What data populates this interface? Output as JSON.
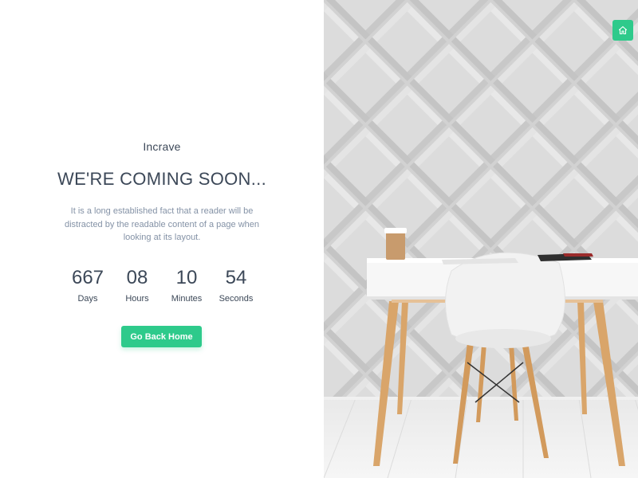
{
  "brand": "Incrave",
  "heading": "WE'RE COMING SOON...",
  "description": "It is a long established fact that a reader will be distracted by the readable content of a page when looking at its layout.",
  "countdown": [
    {
      "value": "667",
      "label": "Days"
    },
    {
      "value": "08",
      "label": "Hours"
    },
    {
      "value": "10",
      "label": "Minutes"
    },
    {
      "value": "54",
      "label": "Seconds"
    }
  ],
  "button": {
    "label": "Go Back Home"
  },
  "top_right": {
    "icon": "home-icon"
  },
  "colors": {
    "accent": "#2eca8b",
    "heading": "#3c4858",
    "muted": "#8492a6"
  }
}
